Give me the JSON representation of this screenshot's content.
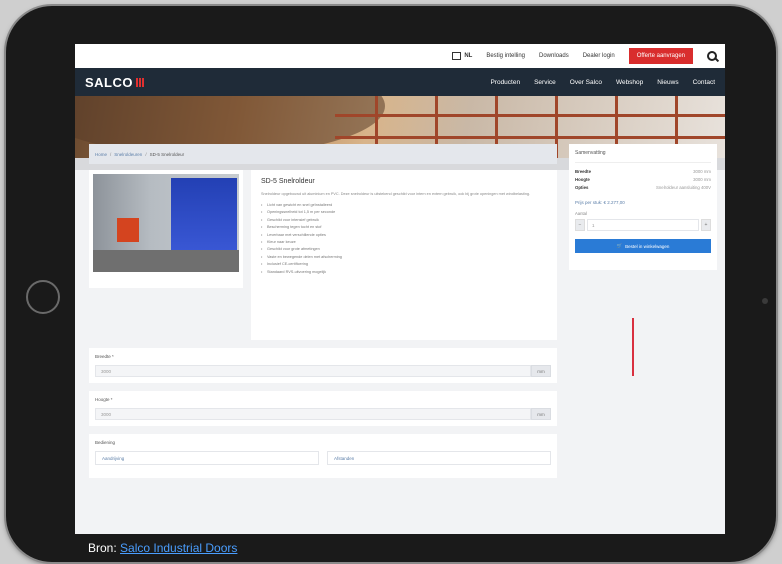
{
  "topbar": {
    "language": "NL",
    "links": [
      "Bestig intelling",
      "Downloads",
      "Dealer login"
    ],
    "offer_label": "Offerte aanvragen"
  },
  "nav": {
    "logo": "SALCO",
    "items": [
      "Producten",
      "Service",
      "Over Salco",
      "Webshop",
      "Nieuws",
      "Contact"
    ]
  },
  "breadcrumb": [
    "Home",
    "Snelroldeuren",
    "SD-5 Snelroldeur"
  ],
  "product": {
    "title": "SD-5 Snelroldeur",
    "intro": "Snelroldeur opgebouwd uit aluminium en PVC. Deze snelroldeur is uitstekend geschikt voor intern en extern gebruik, ook bij grote openingen met windbelasting.",
    "features": [
      "Licht van gewicht en snel geïnstalleerd",
      "Openingssnelheid tot 1,5 m per seconde",
      "Geschikt voor intensief gebruik",
      "Bescherming tegen tocht en stof",
      "Leverbaar met verschillende opties",
      "Kleur naar keuze",
      "Geschikt voor grote afmetingen",
      "Vaste en bewegende delen met afscherming",
      "Inclusief CE-certificering",
      "Standaard RVS-uitvoering mogelijk"
    ]
  },
  "fields": [
    {
      "label": "Breedte *",
      "value": "3000",
      "unit": "mm"
    },
    {
      "label": "Hoogte *",
      "value": "3000",
      "unit": "mm"
    }
  ],
  "bediening": {
    "label": "Bediening",
    "options": [
      "Aandrijving",
      "Afstanden"
    ]
  },
  "sidebar": {
    "title": "Samenvatting",
    "specs": [
      {
        "k": "Breedte",
        "v": "3000 mm"
      },
      {
        "k": "Hoogte",
        "v": "3000 mm"
      },
      {
        "k": "Opties",
        "v": "Snelroldeur aansluiting 400V"
      }
    ],
    "price": "Prijs per stuk: € 2.277,00",
    "qty_label": "Aantal",
    "qty_value": "1",
    "order_label": "Bestel in winkelwagen"
  },
  "caption": {
    "prefix": "Bron: ",
    "link": "Salco Industrial Doors"
  }
}
